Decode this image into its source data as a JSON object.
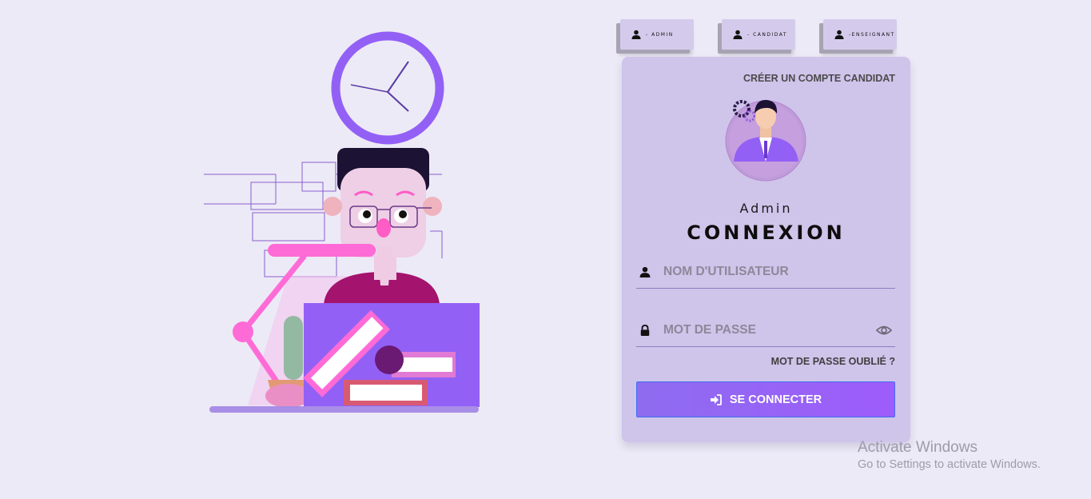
{
  "role_tabs": [
    {
      "label": "- ADMIN",
      "icon": "user-icon"
    },
    {
      "label": "- CANDIDAT",
      "icon": "user-icon"
    },
    {
      "label": "-ENSEIGNANT",
      "icon": "user-icon"
    }
  ],
  "card": {
    "create_account_link": "CRÉER UN COMPTE CANDIDAT",
    "role_title": "Admin",
    "heading": "CONNEXION",
    "username_placeholder": "NOM D'UTILISATEUR",
    "password_placeholder": "MOT DE PASSE",
    "forgot_password": "MOT DE PASSE OUBLIÉ ?",
    "submit_label": "SE CONNECTER"
  },
  "watermark": {
    "title": "Activate Windows",
    "subtitle": "Go to Settings to activate Windows."
  },
  "colors": {
    "background": "#eceaf6",
    "card": "#cfc4ea",
    "accent": "#9360f6",
    "pink": "#ff6bd6"
  }
}
